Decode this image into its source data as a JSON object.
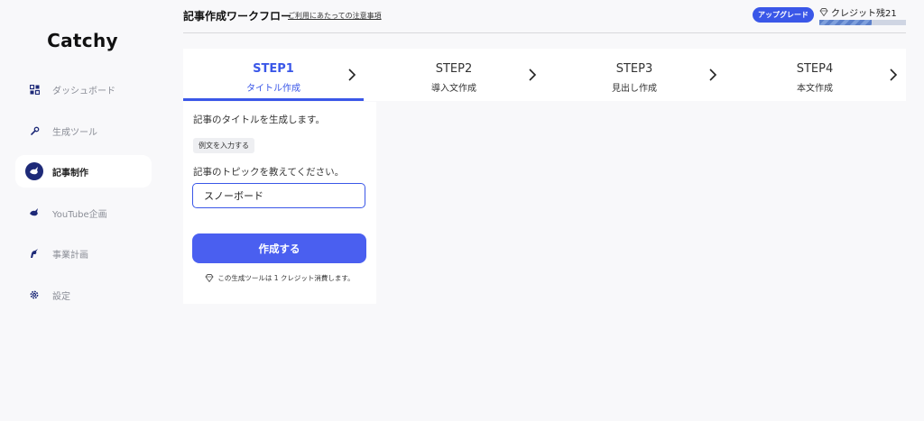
{
  "sidebar": {
    "logo": "Catchy",
    "items": [
      {
        "label": "ダッシュボード",
        "icon": "dashboard-icon",
        "active": false
      },
      {
        "label": "生成ツール",
        "icon": "wrench-icon",
        "active": false
      },
      {
        "label": "記事制作",
        "icon": "bird-icon",
        "active": true
      },
      {
        "label": "YouTube企画",
        "icon": "bird-icon",
        "active": false
      },
      {
        "label": "事業計画",
        "icon": "unicorn-icon",
        "active": false
      },
      {
        "label": "設定",
        "icon": "gear-icon",
        "active": false
      }
    ]
  },
  "header": {
    "title": "記事作成ワークフロー",
    "notice_link": "ご利用にあたっての注意事項",
    "upgrade_label": "アップグレード",
    "credit_label": "クレジット残21",
    "credit_progress": 0.6
  },
  "steps": [
    {
      "num": "STEP1",
      "name": "タイトル作成",
      "active": true
    },
    {
      "num": "STEP2",
      "name": "導入文作成",
      "active": false
    },
    {
      "num": "STEP3",
      "name": "見出し作成",
      "active": false
    },
    {
      "num": "STEP4",
      "name": "本文作成",
      "active": false
    }
  ],
  "form": {
    "description": "記事のタイトルを生成します。",
    "example_button": "例文を入力する",
    "topic_label": "記事のトピックを教えてください。",
    "topic_value": "スノーボード",
    "submit_label": "作成する",
    "cost_note": "この生成ツールは 1 クレジット消費します。"
  },
  "colors": {
    "accent": "#3a57e8",
    "nav_active_icon_bg": "#1e2a78",
    "background": "#f8f8fa"
  }
}
